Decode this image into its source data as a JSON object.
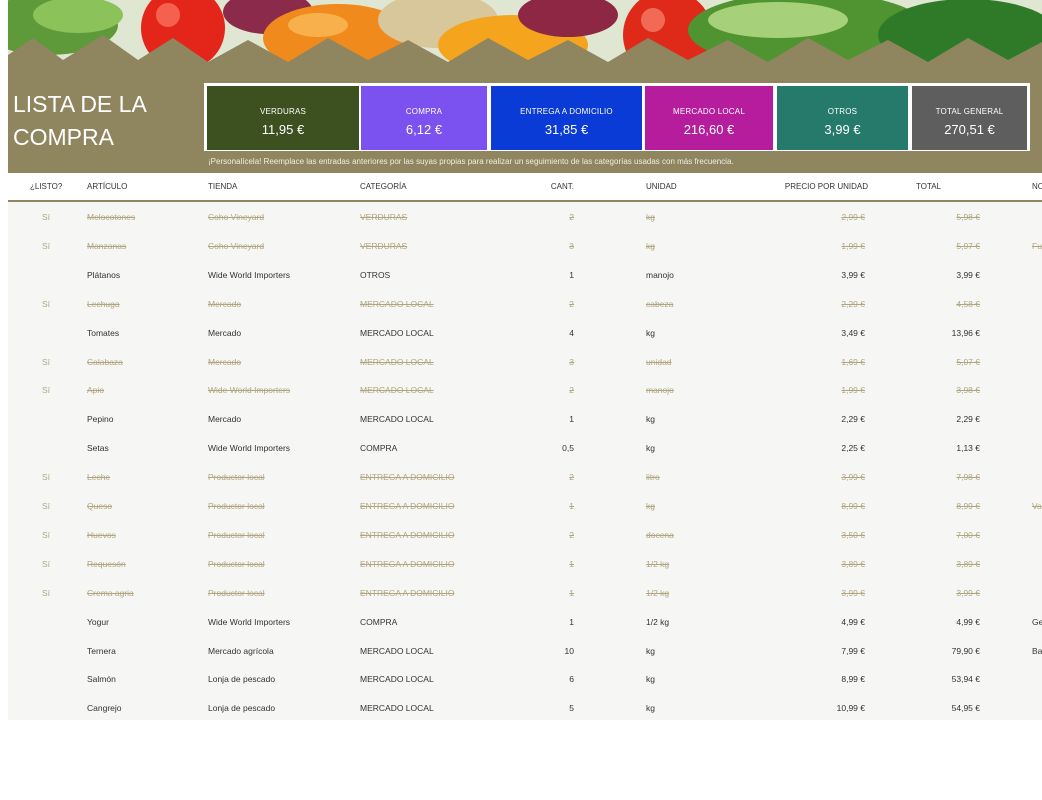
{
  "title": "LISTA DE LA COMPRA",
  "colors": {
    "band": "#8f865f",
    "verduras": "#3d5120",
    "compra": "#7b52f0",
    "entrega": "#0b3bd6",
    "mercado_local": "#b51d9d",
    "otros": "#257a6c",
    "total_general": "#5e5e5e"
  },
  "totals": [
    {
      "label": "VERDURAS",
      "amount": "11,95 €",
      "color": "#3d5120"
    },
    {
      "label": "COMPRA",
      "amount": "6,12 €",
      "color": "#7b52f0"
    },
    {
      "label": "ENTREGA A DOMICILIO",
      "amount": "31,85 €",
      "color": "#0b3bd6"
    },
    {
      "label": "MERCADO LOCAL",
      "amount": "216,60 €",
      "color": "#b51d9d"
    },
    {
      "label": "OTROS",
      "amount": "3,99 €",
      "color": "#257a6c"
    },
    {
      "label": "TOTAL GENERAL",
      "amount": "270,51 €",
      "color": "#5e5e5e"
    }
  ],
  "hint": "¡Personalícela! Reemplace las entradas anteriores por las suyas propias para realizar un seguimiento de las categorías usadas con más frecuencia.",
  "columns": [
    "¿LISTO?",
    "ARTÍCULO",
    "TIENDA",
    "CATEGORÍA",
    "CANT.",
    "UNIDAD",
    "PRECIO POR UNIDAD",
    "TOTAL",
    "NO"
  ],
  "rows": [
    {
      "listo": "Sí",
      "articulo": "Melocotones",
      "tienda": "Coho Vineyard",
      "categoria": "VERDURAS",
      "cant": "2",
      "unidad": "kg",
      "precio": "2,99 €",
      "total": "5,98 €",
      "notas": ""
    },
    {
      "listo": "Sí",
      "articulo": "Manzanas",
      "tienda": "Coho Vineyard",
      "categoria": "VERDURAS",
      "cant": "3",
      "unidad": "kg",
      "precio": "1,99 €",
      "total": "5,97 €",
      "notas": "Fu"
    },
    {
      "listo": "",
      "articulo": "Plátanos",
      "tienda": "Wide World Importers",
      "categoria": "OTROS",
      "cant": "1",
      "unidad": "manojo",
      "precio": "3,99 €",
      "total": "3,99 €",
      "notas": ""
    },
    {
      "listo": "Sí",
      "articulo": "Lechuga",
      "tienda": "Mercado",
      "categoria": "MERCADO LOCAL",
      "cant": "2",
      "unidad": "cabeza",
      "precio": "2,29 €",
      "total": "4,58 €",
      "notas": ""
    },
    {
      "listo": "",
      "articulo": "Tomates",
      "tienda": "Mercado",
      "categoria": "MERCADO LOCAL",
      "cant": "4",
      "unidad": "kg",
      "precio": "3,49 €",
      "total": "13,96 €",
      "notas": ""
    },
    {
      "listo": "Sí",
      "articulo": "Calabaza",
      "tienda": "Mercado",
      "categoria": "MERCADO LOCAL",
      "cant": "3",
      "unidad": "unidad",
      "precio": "1,69 €",
      "total": "5,07 €",
      "notas": ""
    },
    {
      "listo": "Sí",
      "articulo": "Apio",
      "tienda": "Wide World Importers",
      "categoria": "MERCADO LOCAL",
      "cant": "2",
      "unidad": "manojo",
      "precio": "1,99 €",
      "total": "3,98 €",
      "notas": ""
    },
    {
      "listo": "",
      "articulo": "Pepino",
      "tienda": "Mercado",
      "categoria": "MERCADO LOCAL",
      "cant": "1",
      "unidad": "kg",
      "precio": "2,29 €",
      "total": "2,29 €",
      "notas": ""
    },
    {
      "listo": "",
      "articulo": "Setas",
      "tienda": "Wide World Importers",
      "categoria": "COMPRA",
      "cant": "0,5",
      "unidad": "kg",
      "precio": "2,25 €",
      "total": "1,13 €",
      "notas": ""
    },
    {
      "listo": "Sí",
      "articulo": "Leche",
      "tienda": "Productor local",
      "categoria": "ENTREGA A DOMICILIO",
      "cant": "2",
      "unidad": "litro",
      "precio": "3,99 €",
      "total": "7,98 €",
      "notas": ""
    },
    {
      "listo": "Sí",
      "articulo": "Queso",
      "tienda": "Productor local",
      "categoria": "ENTREGA A DOMICILIO",
      "cant": "1",
      "unidad": "kg",
      "precio": "8,99 €",
      "total": "8,99 €",
      "notas": "Va"
    },
    {
      "listo": "Sí",
      "articulo": "Huevos",
      "tienda": "Productor local",
      "categoria": "ENTREGA A DOMICILIO",
      "cant": "2",
      "unidad": "docena",
      "precio": "3,50 €",
      "total": "7,00 €",
      "notas": ""
    },
    {
      "listo": "Sí",
      "articulo": "Requesón",
      "tienda": "Productor local",
      "categoria": "ENTREGA A DOMICILIO",
      "cant": "1",
      "unidad": "1/2 kg",
      "precio": "3,89 €",
      "total": "3,89 €",
      "notas": ""
    },
    {
      "listo": "Sí",
      "articulo": "Crema agria",
      "tienda": "Productor local",
      "categoria": "ENTREGA A DOMICILIO",
      "cant": "1",
      "unidad": "1/2 kg",
      "precio": "3,99 €",
      "total": "3,99 €",
      "notas": ""
    },
    {
      "listo": "",
      "articulo": "Yogur",
      "tienda": "Wide World Importers",
      "categoria": "COMPRA",
      "cant": "1",
      "unidad": "1/2 kg",
      "precio": "4,99 €",
      "total": "4,99 €",
      "notas": "Ge"
    },
    {
      "listo": "",
      "articulo": "Ternera",
      "tienda": "Mercado agrícola",
      "categoria": "MERCADO LOCAL",
      "cant": "10",
      "unidad": "kg",
      "precio": "7,99 €",
      "total": "79,90 €",
      "notas": "Ba"
    },
    {
      "listo": "",
      "articulo": "Salmón",
      "tienda": "Lonja de pescado",
      "categoria": "MERCADO LOCAL",
      "cant": "6",
      "unidad": "kg",
      "precio": "8,99 €",
      "total": "53,94 €",
      "notas": ""
    },
    {
      "listo": "",
      "articulo": "Cangrejo",
      "tienda": "Lonja de pescado",
      "categoria": "MERCADO LOCAL",
      "cant": "5",
      "unidad": "kg",
      "precio": "10,99 €",
      "total": "54,95 €",
      "notas": ""
    }
  ]
}
